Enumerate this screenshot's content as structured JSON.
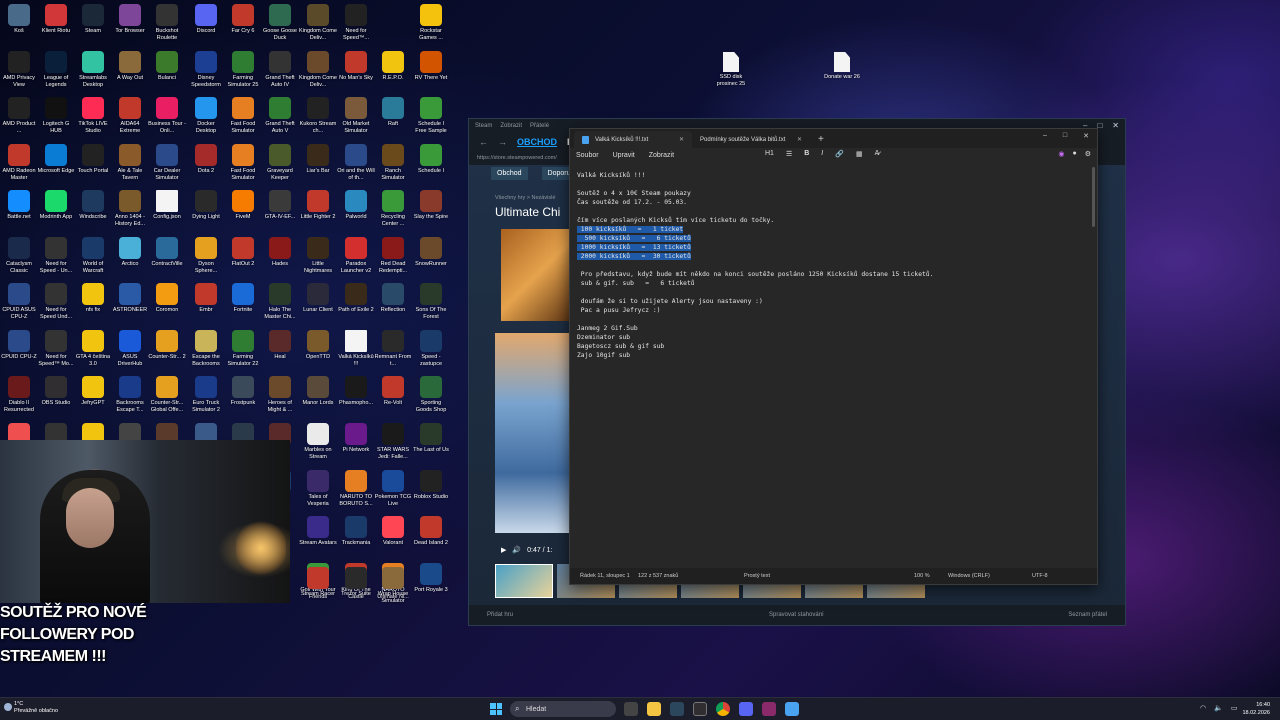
{
  "desktop": {
    "icons": [
      {
        "label": "Koš",
        "color": "#4a6a8a"
      },
      {
        "label": "Klient Riotu",
        "color": "#d13639"
      },
      {
        "label": "Steam",
        "color": "#1b2838"
      },
      {
        "label": "Tor Browser",
        "color": "#7d4698"
      },
      {
        "label": "Buckshot Roulette",
        "color": "#333"
      },
      {
        "label": "Discord",
        "color": "#5865f2"
      },
      {
        "label": "Far Cry 6",
        "color": "#c0392b"
      },
      {
        "label": "Goose Goose Duck",
        "color": "#2d6a4f"
      },
      {
        "label": "Kingdom Come Deliv...",
        "color": "#5a4a2a"
      },
      {
        "label": "Need for Speed™...",
        "color": "#222"
      },
      {
        "label": "Rockstar Games ...",
        "color": "#f4c20d"
      },
      {
        "label": "StreamEle... SE.Live",
        "color": "#1b1f3b"
      },
      {
        "label": "Tribes of Midgard",
        "color": "#3a6ea5"
      },
      {
        "label": "Wreckfest",
        "color": "#6b2d2d"
      },
      {
        "label": "jefry ehm 2",
        "color": "#555"
      },
      {
        "label": "AMD Privacy View",
        "color": "#222"
      },
      {
        "label": "League of Legends",
        "color": "#0a1f3a"
      },
      {
        "label": "Streamlabs Desktop",
        "color": "#31c3a2"
      },
      {
        "label": "A Way Out",
        "color": "#8a6a3a"
      },
      {
        "label": "Bulanci",
        "color": "#3b7a2a"
      },
      {
        "label": "Disney Speedstorm",
        "color": "#1c3f94"
      },
      {
        "label": "Farming Simulator 25",
        "color": "#2e7d32"
      },
      {
        "label": "Grand Theft Auto IV",
        "color": "#333"
      },
      {
        "label": "Kingdom Come Deliv...",
        "color": "#6a4a2a"
      },
      {
        "label": "No Man's Sky",
        "color": "#c0392b"
      },
      {
        "label": "R.E.P.O.",
        "color": "#f1c40f"
      },
      {
        "label": "RV There Yet",
        "color": "#d35400"
      },
      {
        "label": "Trine 4 The Nightma...",
        "color": "#6a3ca5"
      },
      {
        "label": "Zoeti",
        "color": "#444"
      },
      {
        "label": "jefryhul",
        "color": "#444"
      },
      {
        "label": "AMD Product ...",
        "color": "#222"
      },
      {
        "label": "Logitech G HUB",
        "color": "#111"
      },
      {
        "label": "TikTok LIVE Studio",
        "color": "#fe2c55"
      },
      {
        "label": "AIDA64 Extreme",
        "color": "#c0392b"
      },
      {
        "label": "Business Tour - Onli...",
        "color": "#e91e63"
      },
      {
        "label": "Docker Desktop",
        "color": "#2496ed"
      },
      {
        "label": "Fast Food Simulator",
        "color": "#e67e22"
      },
      {
        "label": "Grand Theft Auto V",
        "color": "#2e7d32"
      },
      {
        "label": "Kukoro Stream ch...",
        "color": "#222"
      },
      {
        "label": "Old Market Simulator",
        "color": "#7a5a3a"
      },
      {
        "label": "Raft",
        "color": "#2a7a9a"
      },
      {
        "label": "Schedule I Free Sample",
        "color": "#3a9a3a"
      },
      {
        "label": "Super Toy Car",
        "color": "#c0392b"
      },
      {
        "label": "AMD Radeon Master",
        "color": "#c0392b"
      },
      {
        "label": "Microsoft Edge",
        "color": "#0a7cd3"
      },
      {
        "label": "Touch Portal",
        "color": "#222"
      },
      {
        "label": "Ale & Tale Tavern",
        "color": "#8a5a2a"
      },
      {
        "label": "Car Dealer Simulator",
        "color": "#2a4a8a"
      },
      {
        "label": "Dota 2",
        "color": "#a52a2a"
      },
      {
        "label": "Fast Food Simulator",
        "color": "#e67e22"
      },
      {
        "label": "Graveyard Keeper",
        "color": "#4a5a2a"
      },
      {
        "label": "Liar's Bar",
        "color": "#3a2a1a"
      },
      {
        "label": "Ori and the Will of th...",
        "color": "#2a4a8a"
      },
      {
        "label": "Ranch Simulator",
        "color": "#6a4a1a"
      },
      {
        "label": "Schedule I",
        "color": "#3a9a3a"
      },
      {
        "label": "Sword Saga",
        "color": "#4a3a2a"
      },
      {
        "label": "Battle.net",
        "color": "#148eff"
      },
      {
        "label": "Modrinth App",
        "color": "#1bd96a"
      },
      {
        "label": "Windscribe",
        "color": "#1e3a5f"
      },
      {
        "label": "Anno 1404 - History Ed...",
        "color": "#7a5a2a"
      },
      {
        "label": "Config.json",
        "color": "#f4f4f4"
      },
      {
        "label": "Dying Light",
        "color": "#2a2a2a"
      },
      {
        "label": "FiveM",
        "color": "#f57c00"
      },
      {
        "label": "GTA-IV-EF...",
        "color": "#3a3a3a"
      },
      {
        "label": "Little Fighter 2",
        "color": "#c0392b"
      },
      {
        "label": "Palworld",
        "color": "#2a8ac0"
      },
      {
        "label": "Recycling Center ...",
        "color": "#3a9a3a"
      },
      {
        "label": "Slay the Spire",
        "color": "#8a3a2a"
      },
      {
        "label": "Tavern Manager",
        "color": "#6a4a2a"
      },
      {
        "label": "Cataclysm Classic",
        "color": "#1a2a4a"
      },
      {
        "label": "Need for Speed - Un...",
        "color": "#333"
      },
      {
        "label": "World of Warcraft",
        "color": "#1a3a6a"
      },
      {
        "label": "Arctico",
        "color": "#4ab0d8"
      },
      {
        "label": "ContractVille",
        "color": "#2a6a9a"
      },
      {
        "label": "Dyson Sphere...",
        "color": "#e6a020"
      },
      {
        "label": "FlatOut 2",
        "color": "#c0392b"
      },
      {
        "label": "Hades",
        "color": "#8a1a1a"
      },
      {
        "label": "Little Nightmares",
        "color": "#3a2a1a"
      },
      {
        "label": "Paradox Launcher v2",
        "color": "#d32f2f"
      },
      {
        "label": "Red Dead Redempti...",
        "color": "#8a1a1a"
      },
      {
        "label": "SnowRunner",
        "color": "#6a4a2a"
      },
      {
        "label": "Terraria",
        "color": "#3a7a3a"
      },
      {
        "label": "CPUID ASUS CPU-Z",
        "color": "#2a4a8a"
      },
      {
        "label": "Need for Speed Und...",
        "color": "#333"
      },
      {
        "label": "nfs fix",
        "color": "#f1c40f"
      },
      {
        "label": "ASTRONEER",
        "color": "#2a5aa5"
      },
      {
        "label": "Coromon",
        "color": "#f39c12"
      },
      {
        "label": "Embr",
        "color": "#c0392b"
      },
      {
        "label": "Fortnite",
        "color": "#1a6ad8"
      },
      {
        "label": "Halo The Master Chi...",
        "color": "#2a3a2a"
      },
      {
        "label": "Lunar Client",
        "color": "#2a2a3a"
      },
      {
        "label": "Path of Exile 2",
        "color": "#3a2a1a"
      },
      {
        "label": "Reflection",
        "color": "#2a4a6a"
      },
      {
        "label": "Sons Of The Forest",
        "color": "#2a3a2a"
      },
      {
        "label": "The Sims 4",
        "color": "#3a9a3a"
      },
      {
        "label": "CPUID CPU-Z",
        "color": "#2a4a8a"
      },
      {
        "label": "Need for Speed™ Mo...",
        "color": "#333"
      },
      {
        "label": "GTA 4 čeština 3.0",
        "color": "#f1c40f"
      },
      {
        "label": "ASUS DriverHub",
        "color": "#1a5ad8"
      },
      {
        "label": "Counter-Str... 2",
        "color": "#e6a020"
      },
      {
        "label": "Escape the Backrooms",
        "color": "#c9b45a"
      },
      {
        "label": "Farming Simulator 22",
        "color": "#2e7d32"
      },
      {
        "label": "Heal",
        "color": "#5a2a2a"
      },
      {
        "label": "OpenTTD",
        "color": "#7a5a2a"
      },
      {
        "label": "Valká Kicksíků !!!",
        "color": "#f4f4f4"
      },
      {
        "label": "Remnant From t...",
        "color": "#2a2a2a"
      },
      {
        "label": "Speed - zastupce",
        "color": "#1a3a6a"
      },
      {
        "label": "The Forest",
        "color": "#2a3a2a"
      },
      {
        "label": "Diablo II Resurrected",
        "color": "#6a1a1a"
      },
      {
        "label": "OBS Studio",
        "color": "#302e31"
      },
      {
        "label": "JefryGPT",
        "color": "#f1c40f"
      },
      {
        "label": "Backrooms Escape T...",
        "color": "#1a3a8a"
      },
      {
        "label": "Counter-Str... Global Offe...",
        "color": "#e6a020"
      },
      {
        "label": "Euro Truck Simulator 2",
        "color": "#1a3a8a"
      },
      {
        "label": "Frostpunk",
        "color": "#3a4a5a"
      },
      {
        "label": "Heroes of Might & ...",
        "color": "#6a4a2a"
      },
      {
        "label": "Manor Lords",
        "color": "#5a4a3a"
      },
      {
        "label": "Phasmopho...",
        "color": "#1a1a1a"
      },
      {
        "label": "Re-Volt",
        "color": "#c0392b"
      },
      {
        "label": "Sporting Goods Shop",
        "color": "#2a6a3a"
      },
      {
        "label": "Tekken 8",
        "color": "#3a3a3a"
      },
      {
        "label": "EA",
        "color": "#f04f4f"
      },
      {
        "label": "",
        "color": "#333"
      },
      {
        "label": "",
        "color": "#f1c40f"
      },
      {
        "label": "",
        "color": "#444"
      },
      {
        "label": "",
        "color": "#5a3a2a"
      },
      {
        "label": "",
        "color": "#3a5a8a"
      },
      {
        "label": "",
        "color": "#2a3a4a"
      },
      {
        "label": "",
        "color": "#5a2a2a"
      },
      {
        "label": "Marbles on Stream",
        "color": "#eaeaea"
      },
      {
        "label": "Pi Network",
        "color": "#6a1a8a"
      },
      {
        "label": "STAR WARS Jedi: Falle...",
        "color": "#1a1a1a"
      },
      {
        "label": "The Last of Us",
        "color": "#2a3a2a"
      },
      {
        "label": "Medieval Dynasty",
        "color": "#5a4a2a"
      },
      {
        "label": "Play Felscing - zastupce",
        "color": "#3a9a3a"
      },
      {
        "label": "Roadside Resear...",
        "color": "#c0392b"
      },
      {
        "label": "Stationeers",
        "color": "#2a4a6a"
      },
      {
        "label": "TrackMania Center",
        "color": "#1a3a6a"
      },
      {
        "label": "Metro Exodus",
        "color": "#2a2a2a"
      },
      {
        "label": "Podmínky soutěže Vál...",
        "color": "#f4f4f4"
      },
      {
        "label": "Roblox Player",
        "color": "#3a5ae8"
      },
      {
        "label": "Stellaris",
        "color": "#1a3a6a"
      },
      {
        "label": "Tales of Vesperia",
        "color": "#3a2a6a"
      },
      {
        "label": "NARUTO TO BORUTO S...",
        "color": "#e67e22"
      },
      {
        "label": "Pokemon TCG Live",
        "color": "#1a4a9a"
      },
      {
        "label": "Roblox Studio",
        "color": "#222"
      },
      {
        "label": "Stream Avatars",
        "color": "#3a2a8a"
      },
      {
        "label": "Trackmania",
        "color": "#1a3a6a"
      },
      {
        "label": "Valorant",
        "color": "#ff4655"
      },
      {
        "label": "Dead Island 2",
        "color": "#c0392b"
      },
      {
        "label": "Fallout 4",
        "color": "#2a5a2a"
      },
      {
        "label": "Golf With Your Friends",
        "color": "#3a9a3a"
      },
      {
        "label": "King Of The Castle",
        "color": "#c0392b"
      },
      {
        "label": "NARUTO Ultimate Ni...",
        "color": "#e67e22"
      },
      {
        "label": "Port Royale 3",
        "color": "#1a4a8a"
      },
      {
        "label": "Rocket League®",
        "color": "#1a5ad8"
      },
      {
        "label": "Stream Racer",
        "color": "#c0392b"
      },
      {
        "label": "Trezor Suite",
        "color": "#2a2a2a"
      },
      {
        "label": "Wrap House Simulator",
        "color": "#8a6a3a"
      }
    ],
    "files": [
      {
        "label": "SSD disk prosinec 25"
      },
      {
        "label": "Donate war 26"
      }
    ]
  },
  "steam": {
    "titlebar": [
      "Steam",
      "Zobrazit",
      "Přátelé"
    ],
    "nav": [
      "OBCHOD",
      "KN"
    ],
    "url": "https://store.steampowered.com/",
    "store_nav": [
      "Obchod",
      "Doporuče"
    ],
    "breadcrumbs": "Všechny hry  >  Nezávislé",
    "game_title": "Ultimate Chi",
    "player_time": "0:47 / 1:",
    "bottom_left": "Přidat hru",
    "bottom_mid": "Spravovat stahování",
    "bottom_right": "Seznam přátel"
  },
  "notepad": {
    "tabs": [
      {
        "label": "Valká Kicksíků !!!.txt",
        "active": true
      },
      {
        "label": "Podmínky soutěže Válka bitů.txt",
        "active": false
      }
    ],
    "menu": [
      "Soubor",
      "Upravit",
      "Zobrazit"
    ],
    "heading_select": "H1",
    "lines": [
      "Valká Kicksíků !!!",
      "",
      "Soutěž o 4 x 10€ Steam poukazy",
      "Čas soutěže od 17.2. - 05.03.",
      "",
      "čím více poslaných Kicksů tím více ticketu do točky.",
      " 100 kicksíků   =   1 ticket",
      "  500 kicksíků   =   6 ticketů",
      " 1000 kicksíků   =  13 ticketů",
      " 2000 kicksíků   =  30 ticketů",
      "",
      " Pro představu, když bude mít někdo na konci soutěže posláno 1250 Kicksíků dostane 15 ticketů.",
      " sub & gif. sub   =   6 ticketů",
      "",
      " doufám že si to užijete Alerty jsou nastaveny :)",
      " Pac a pusu Jefrycz :)",
      "",
      "Janmeg 2 Gif.Sub",
      "Dzeminator sub",
      "Bagetoscz sub & gif sub",
      "Zajo 10gif sub"
    ],
    "highlight_lines": [
      6,
      7,
      8,
      9
    ],
    "status": {
      "position": "Řádek 11, sloupec 1",
      "count": "122 z 537 znaků",
      "format": "Prostý text",
      "zoom": "100 %",
      "eol": "Windows (CRLF)",
      "encoding": "UTF-8"
    }
  },
  "overlay_text": "SOUTĚŽ PRO NOVÉ FOLLOWERY POD STREAMEM !!!",
  "taskbar": {
    "weather_temp": "1°C",
    "weather_desc": "Převážně oblačno",
    "search_placeholder": "Hledat",
    "time": "16:40",
    "date": "18.02.2026"
  }
}
